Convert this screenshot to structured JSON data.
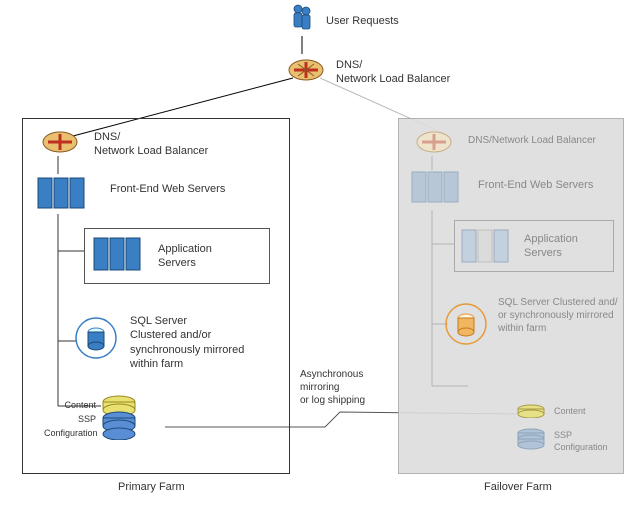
{
  "chart_data": {
    "type": "network-diagram",
    "title": "Primary Farm and Failover Farm architecture",
    "nodes": [
      {
        "id": "user-requests",
        "label": "User Requests"
      },
      {
        "id": "dns-top",
        "label": "DNS/\nNetwork Load Balancer"
      },
      {
        "id": "primary-farm",
        "label": "Primary Farm",
        "children": [
          {
            "id": "p-dns",
            "label": "DNS/\nNetwork Load Balancer"
          },
          {
            "id": "p-web",
            "label": "Front-End Web Servers"
          },
          {
            "id": "p-app",
            "label": "Application\nServers"
          },
          {
            "id": "p-sql",
            "label": "SQL Server\nClustered and/or\nsynchronously mirrored\nwithin farm"
          },
          {
            "id": "p-db-content",
            "label": "Content"
          },
          {
            "id": "p-db-ssp",
            "label": "SSP"
          },
          {
            "id": "p-db-config",
            "label": "Configuration"
          }
        ]
      },
      {
        "id": "failover-farm",
        "label": "Failover Farm",
        "children": [
          {
            "id": "f-dns",
            "label": "DNS/Network Load Balancer"
          },
          {
            "id": "f-web",
            "label": "Front-End Web Servers"
          },
          {
            "id": "f-app",
            "label": "Application\nServers"
          },
          {
            "id": "f-sql",
            "label": "SQL Server Clustered and/\nor synchronously mirrored\nwithin farm"
          },
          {
            "id": "f-db-content",
            "label": "Content"
          },
          {
            "id": "f-db-ssp",
            "label": "SSP"
          },
          {
            "id": "f-db-config",
            "label": "Configuration"
          }
        ]
      }
    ],
    "edges": [
      {
        "from": "user-requests",
        "to": "dns-top"
      },
      {
        "from": "dns-top",
        "to": "p-dns"
      },
      {
        "from": "dns-top",
        "to": "f-dns"
      },
      {
        "from": "p-dns",
        "to": "p-web"
      },
      {
        "from": "p-web",
        "to": "p-app"
      },
      {
        "from": "p-app",
        "to": "p-sql"
      },
      {
        "from": "p-sql",
        "to": "p-db-content"
      },
      {
        "from": "p-db-content",
        "to": "f-db-content",
        "label": "Asynchronous\nmirroring\nor log shipping"
      }
    ]
  },
  "top": {
    "user_requests": "User Requests",
    "dns": "DNS/\nNetwork Load Balancer"
  },
  "primary": {
    "title": "Primary Farm",
    "dns": "DNS/\nNetwork Load Balancer",
    "web": "Front-End Web Servers",
    "app": "Application\nServers",
    "sql": "SQL Server\nClustered and/or\nsynchronously mirrored\nwithin farm",
    "db_content": "Content",
    "db_ssp": "SSP",
    "db_config": "Configuration"
  },
  "failover": {
    "title": "Failover Farm",
    "dns": "DNS/Network Load Balancer",
    "web": "Front-End Web Servers",
    "app": "Application\nServers",
    "sql": "SQL Server Clustered and/\nor synchronously mirrored\nwithin farm",
    "db_content": "Content",
    "db_ssp": "SSP",
    "db_config": "Configuration"
  },
  "link": {
    "mirror": "Asynchronous\nmirroring\nor log shipping"
  }
}
